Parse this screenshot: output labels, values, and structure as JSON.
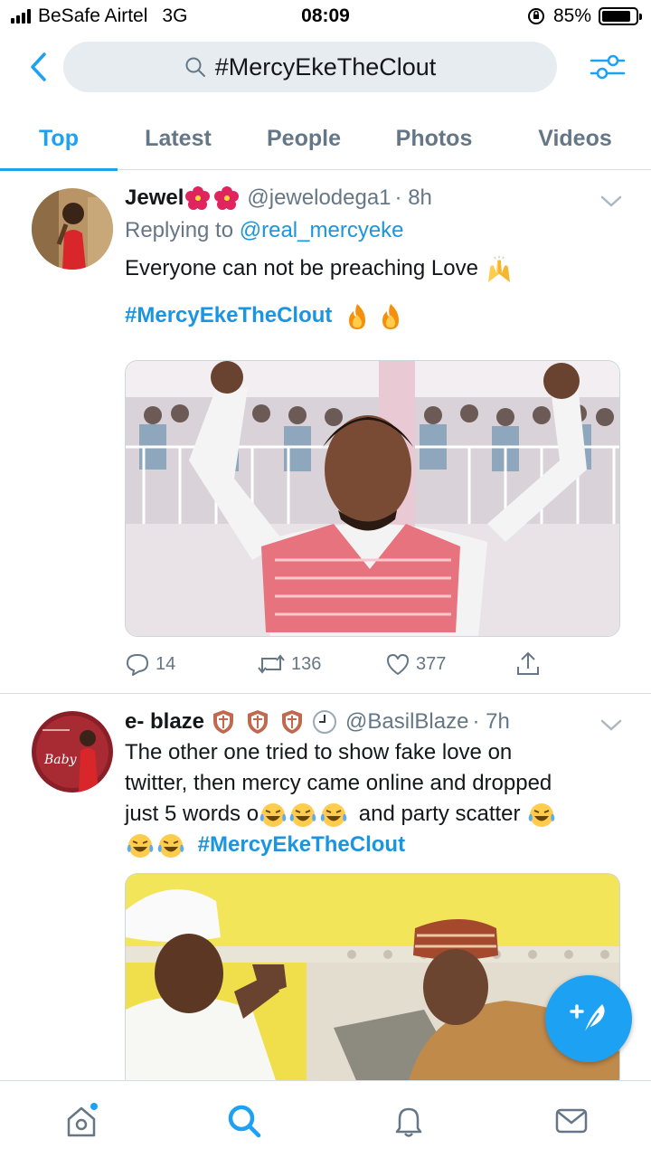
{
  "status_bar": {
    "carrier": "BeSafe Airtel",
    "network": "3G",
    "time": "08:09",
    "battery": "85%",
    "battery_level": 0.85
  },
  "search": {
    "query": "#MercyEkeTheClout",
    "back_icon": "chevron-left-icon",
    "filter_icon": "sliders-icon",
    "search_icon": "search-icon"
  },
  "tabs": [
    {
      "label": "Top",
      "active": true
    },
    {
      "label": "Latest",
      "active": false
    },
    {
      "label": "People",
      "active": false
    },
    {
      "label": "Photos",
      "active": false
    },
    {
      "label": "Videos",
      "active": false
    }
  ],
  "tweets": [
    {
      "name": "Jewel",
      "handle": "@jewelodega1",
      "time": "· 8h",
      "replying_prefix": "Replying to",
      "replying_to": "@real_mercyeke",
      "text": "Everyone can not be preaching Love",
      "hashtag": "#MercyEkeTheClout",
      "replies": "14",
      "retweets": "136",
      "likes": "377"
    },
    {
      "name": "e- blaze",
      "handle": "@BasilBlaze",
      "time": "· 7h",
      "text_line1": "The other one tried to show fake love on",
      "text_line2": "twitter, then mercy came online and dropped",
      "text_line3a": "just 5 words o",
      "text_line3b": "and party scatter",
      "hashtag": "#MercyEkeTheClout",
      "avatar_text": "Baby"
    }
  ],
  "colors": {
    "accent": "#1da1f2",
    "link": "#1b95e0",
    "secondary_text": "#657786"
  },
  "bottom_nav": [
    "home-icon",
    "search-icon",
    "bell-icon",
    "mail-icon"
  ]
}
